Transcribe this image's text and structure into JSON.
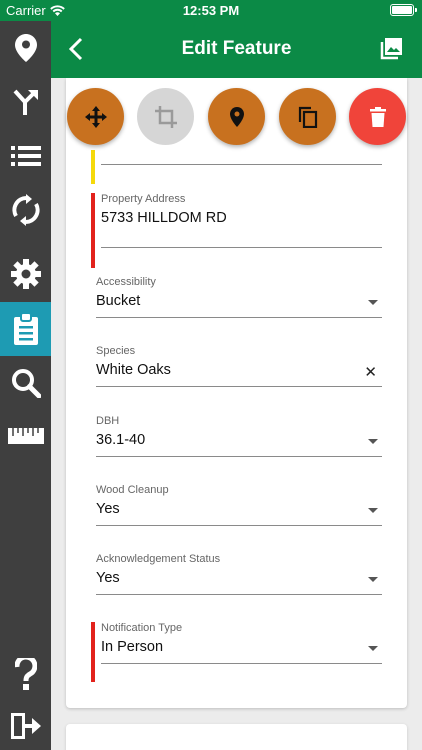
{
  "status_bar": {
    "carrier": "Carrier",
    "time": "12:53 PM"
  },
  "header": {
    "title": "Edit Feature"
  },
  "colors": {
    "brand_green": "#0b8a46",
    "sidebar_bg": "#3f3f3f",
    "sidebar_active": "#1e9bb3",
    "action_orange": "#c8711f",
    "action_disabled": "#d6d6d6",
    "action_delete": "#f0443a",
    "required_red": "#e2221c",
    "warning_yellow": "#f5d90a"
  },
  "sidebar": {
    "items": [
      {
        "icon": "map-pin-icon"
      },
      {
        "icon": "route-merge-icon"
      },
      {
        "icon": "list-icon"
      },
      {
        "icon": "sync-icon"
      },
      {
        "icon": "gear-icon"
      },
      {
        "icon": "clipboard-icon",
        "active": true
      },
      {
        "icon": "search-icon"
      },
      {
        "icon": "ruler-icon"
      },
      {
        "icon": "help-icon"
      },
      {
        "icon": "logout-icon"
      }
    ]
  },
  "actions": [
    {
      "icon": "move-icon"
    },
    {
      "icon": "crop-icon",
      "disabled": true
    },
    {
      "icon": "map-pin-icon"
    },
    {
      "icon": "copy-icon"
    },
    {
      "icon": "trash-icon"
    }
  ],
  "form": {
    "property_address": {
      "label": "Property Address",
      "value": "5733 HILLDOM RD"
    },
    "accessibility": {
      "label": "Accessibility",
      "value": "Bucket"
    },
    "species": {
      "label": "Species",
      "value": "White Oaks"
    },
    "dbh": {
      "label": "DBH",
      "value": "36.1-40"
    },
    "wood_cleanup": {
      "label": "Wood Cleanup",
      "value": "Yes"
    },
    "acknowledgement_status": {
      "label": "Acknowledgement Status",
      "value": "Yes"
    },
    "notification_type": {
      "label": "Notification Type",
      "value": "In Person"
    }
  }
}
